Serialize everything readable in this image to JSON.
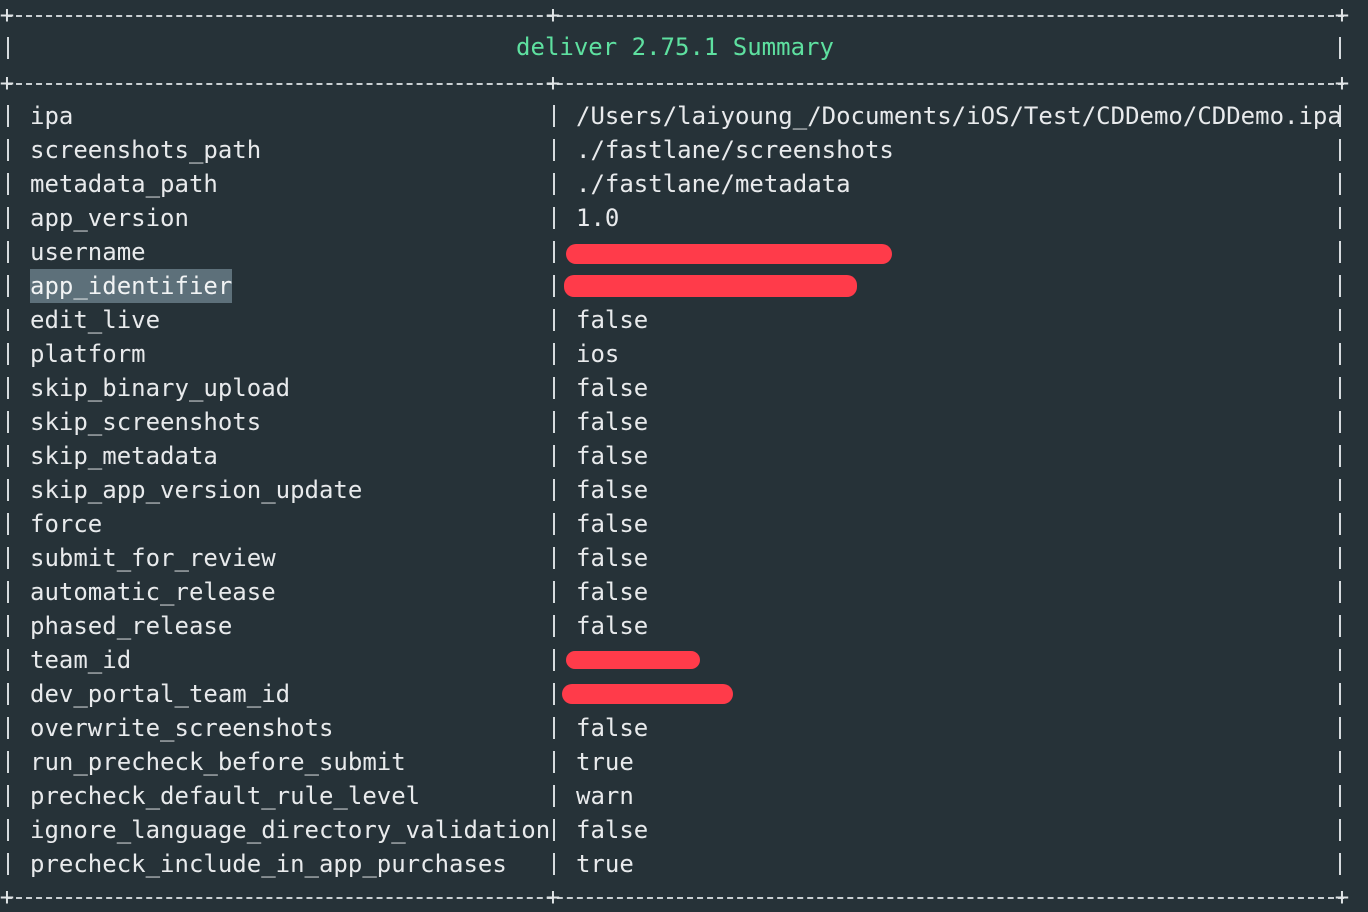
{
  "title": "deliver 2.75.1 Summary",
  "colors": {
    "background": "#263238",
    "title": "#5ee0a0",
    "text": "#e8eaec",
    "redaction": "#ff3b4a",
    "selection": "#5d707a"
  },
  "rows": [
    {
      "key": "ipa",
      "value": "/Users/laiyoung_/Documents/iOS/Test/CDDemo/CDDemo.ipa",
      "redacted": false
    },
    {
      "key": "screenshots_path",
      "value": "./fastlane/screenshots",
      "redacted": false
    },
    {
      "key": "metadata_path",
      "value": "./fastlane/metadata",
      "redacted": false
    },
    {
      "key": "app_version",
      "value": "1.0",
      "redacted": false
    },
    {
      "key": "username",
      "value": "",
      "redacted": true
    },
    {
      "key": "app_identifier",
      "value": "",
      "redacted": true,
      "selected": true
    },
    {
      "key": "edit_live",
      "value": "false",
      "redacted": false
    },
    {
      "key": "platform",
      "value": "ios",
      "redacted": false
    },
    {
      "key": "skip_binary_upload",
      "value": "false",
      "redacted": false
    },
    {
      "key": "skip_screenshots",
      "value": "false",
      "redacted": false
    },
    {
      "key": "skip_metadata",
      "value": "false",
      "redacted": false
    },
    {
      "key": "skip_app_version_update",
      "value": "false",
      "redacted": false
    },
    {
      "key": "force",
      "value": "false",
      "redacted": false
    },
    {
      "key": "submit_for_review",
      "value": "false",
      "redacted": false
    },
    {
      "key": "automatic_release",
      "value": "false",
      "redacted": false
    },
    {
      "key": "phased_release",
      "value": "false",
      "redacted": false
    },
    {
      "key": "team_id",
      "value": "",
      "redacted": true
    },
    {
      "key": "dev_portal_team_id",
      "value": "",
      "redacted": true
    },
    {
      "key": "overwrite_screenshots",
      "value": "false",
      "redacted": false
    },
    {
      "key": "run_precheck_before_submit",
      "value": "true",
      "redacted": false
    },
    {
      "key": "precheck_default_rule_level",
      "value": "warn",
      "redacted": false
    },
    {
      "key": "ignore_language_directory_validation",
      "value": "false",
      "redacted": false
    },
    {
      "key": "precheck_include_in_app_purchases",
      "value": "true",
      "redacted": false
    }
  ]
}
